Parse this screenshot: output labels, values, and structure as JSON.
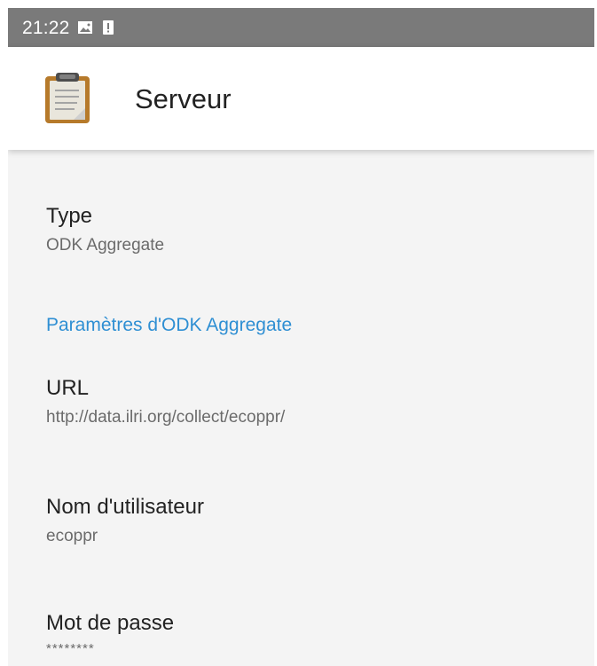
{
  "status_bar": {
    "time": "21:22",
    "icons": [
      "image-icon",
      "alert-icon"
    ]
  },
  "app_bar": {
    "title": "Serveur",
    "icon": "clipboard-icon"
  },
  "preferences": {
    "type": {
      "title": "Type",
      "value": "ODK Aggregate"
    },
    "section_header": "Paramètres d'ODK Aggregate",
    "url": {
      "title": "URL",
      "value": "http://data.ilri.org/collect/ecoppr/"
    },
    "username": {
      "title": "Nom d'utilisateur",
      "value": "ecoppr"
    },
    "password": {
      "title": "Mot de passe",
      "value": "********"
    }
  },
  "colors": {
    "status_bar": "#7a7a7a",
    "app_bar": "#ffffff",
    "background": "#f4f4f4",
    "accent": "#2f8fd3",
    "primary_text": "#222222",
    "secondary_text": "#6b6b6b"
  }
}
